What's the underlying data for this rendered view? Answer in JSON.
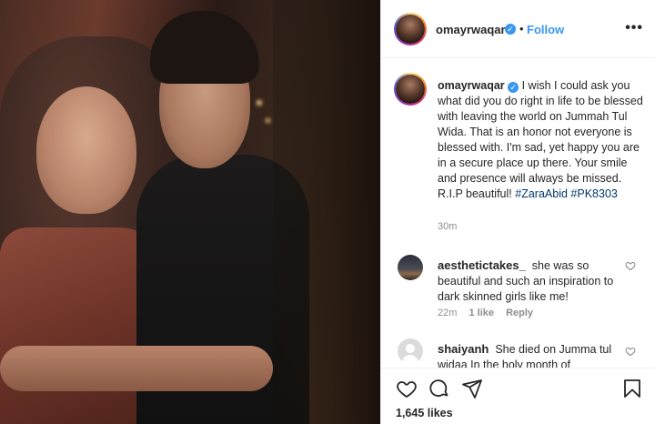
{
  "post": {
    "username": "omayrwaqar",
    "verified_glyph": "✓",
    "separator": "•",
    "follow_label": "Follow",
    "more_label": "•••",
    "caption": {
      "username": "omayrwaqar",
      "text": " I wish I could ask you what did you do right in life to be blessed with leaving the world on Jummah Tul Wida. That is an honor not everyone is blessed with. I'm sad, yet happy you are in a secure place up there. Your smile and presence will always be missed. R.I.P beautiful! ",
      "hashtags": [
        "#ZaraAbid",
        "#PK8303"
      ],
      "time": "30m"
    }
  },
  "comments": [
    {
      "username": "aesthetictakes_",
      "text": "she was so beautiful and such an inspiration to dark skinned girls like me!",
      "time": "22m",
      "likes": "1 like",
      "reply_label": "Reply"
    },
    {
      "username": "shaiyanh",
      "text": "She died on Jumma tul widaa In the holy month of"
    }
  ],
  "actions": {
    "icons": [
      "heart-icon",
      "comment-icon",
      "share-icon",
      "bookmark-icon"
    ],
    "likes_count": "1,645 likes"
  },
  "colors": {
    "link_blue": "#3897f0",
    "hashtag": "#00376b",
    "muted": "#8e8e8e",
    "text": "#262626"
  }
}
